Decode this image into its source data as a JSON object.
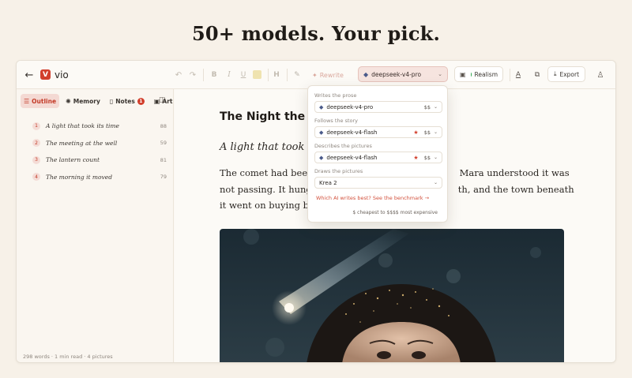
{
  "headline": "50+ models. Your pick.",
  "app": {
    "brand": "vio",
    "logo_letter": "V"
  },
  "toolbar": {
    "rewrite_label": "Rewrite",
    "model_selected": "deepseek-v4-pro",
    "realism_label": "Realism",
    "export_label": "Export"
  },
  "sidebar": {
    "tabs": [
      {
        "label": "Outline",
        "active": true
      },
      {
        "label": "Memory",
        "active": false
      },
      {
        "label": "Notes",
        "active": false,
        "badge": "1"
      },
      {
        "label": "Art",
        "active": false
      }
    ],
    "outline": [
      {
        "num": "1",
        "title": "A light that took its time",
        "count": "88"
      },
      {
        "num": "2",
        "title": "The meeting at the well",
        "count": "59"
      },
      {
        "num": "3",
        "title": "The lantern count",
        "count": "81"
      },
      {
        "num": "4",
        "title": "The morning it moved",
        "count": "79"
      }
    ],
    "status": "298 words · 1 min read · 4 pictures"
  },
  "document": {
    "title": "The Night the Co",
    "subtitle": "A light that took its",
    "para_line1_a": "The comet had been",
    "para_line1_b": "Mara understood it was",
    "para_line2_a": "not passing. It hung",
    "para_line2_b": "th, and the town beneath",
    "para_line3": "it went on buying bre"
  },
  "model_dropdown": {
    "sections": [
      {
        "label": "Writes the prose",
        "model": "deepseek-v4-pro",
        "starred": false,
        "price": "$$"
      },
      {
        "label": "Follows the story",
        "model": "deepseek-v4-flash",
        "starred": true,
        "price": "$$"
      },
      {
        "label": "Describes the pictures",
        "model": "deepseek-v4-flash",
        "starred": true,
        "price": "$$"
      },
      {
        "label": "Draws the pictures",
        "model": "Krea 2",
        "starred": false,
        "price": ""
      }
    ],
    "benchmark_link": "Which AI writes best? See the benchmark →",
    "price_note": "$ cheapest to $$$$ most expensive"
  },
  "colors": {
    "accent": "#d23f2c",
    "background": "#f7f1e8",
    "status_green": "#2fa84f"
  }
}
